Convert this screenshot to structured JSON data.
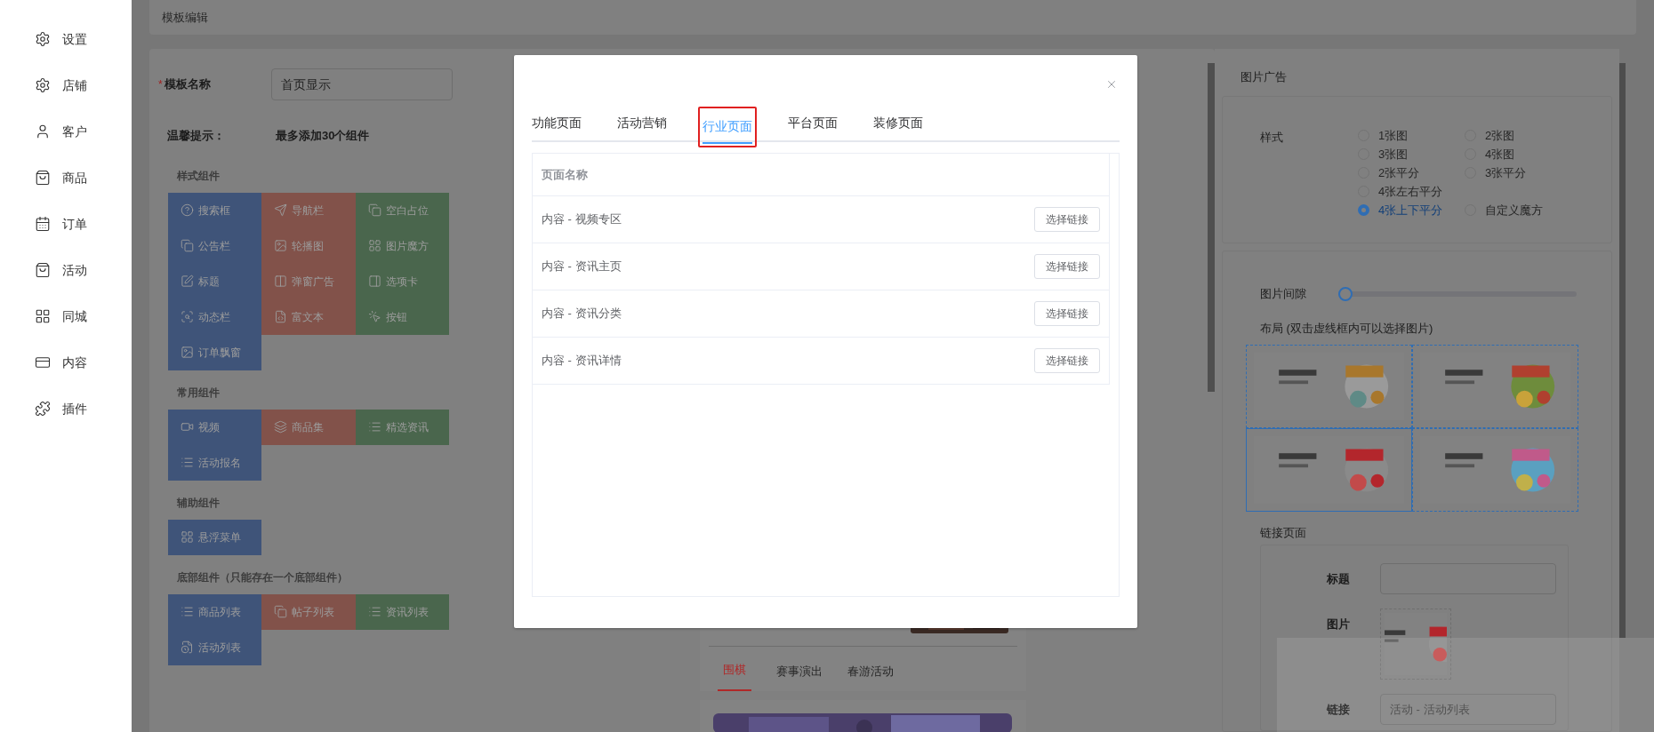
{
  "sidebar": {
    "items": [
      {
        "label": "设置"
      },
      {
        "label": "店铺"
      },
      {
        "label": "客户"
      },
      {
        "label": "商品"
      },
      {
        "label": "订单"
      },
      {
        "label": "活动"
      },
      {
        "label": "同城"
      },
      {
        "label": "内容"
      },
      {
        "label": "插件"
      }
    ]
  },
  "header": {
    "title": "模板编辑"
  },
  "editor": {
    "required_mark": "*",
    "name_label": "模板名称",
    "name_value": "首页显示",
    "tip_label": "温馨提示：",
    "tip_text": "最多添加30个组件",
    "groups": [
      {
        "title": "样式组件",
        "items": [
          {
            "label": "搜索框",
            "color": "#3f5479"
          },
          {
            "label": "导航栏",
            "color": "#82524a"
          },
          {
            "label": "空白占位",
            "color": "#4a664d"
          },
          {
            "label": "公告栏",
            "color": "#3f5479"
          },
          {
            "label": "轮播图",
            "color": "#82524a"
          },
          {
            "label": "图片魔方",
            "color": "#4a664d"
          },
          {
            "label": "标题",
            "color": "#3f5479"
          },
          {
            "label": "弹窗广告",
            "color": "#82524a"
          },
          {
            "label": "选项卡",
            "color": "#4a664d"
          },
          {
            "label": "动态栏",
            "color": "#3f5479"
          },
          {
            "label": "富文本",
            "color": "#82524a"
          },
          {
            "label": "按钮",
            "color": "#4a664d"
          },
          {
            "label": "订单飘窗",
            "color": "#3f5479"
          }
        ]
      },
      {
        "title": "常用组件",
        "items": [
          {
            "label": "视频",
            "color": "#3f5479"
          },
          {
            "label": "商品集",
            "color": "#82524a"
          },
          {
            "label": "精选资讯",
            "color": "#4a664d"
          },
          {
            "label": "活动报名",
            "color": "#3f5479"
          }
        ]
      },
      {
        "title": "辅助组件",
        "items": [
          {
            "label": "悬浮菜单",
            "color": "#3f5479"
          }
        ]
      },
      {
        "title": "底部组件（只能存在一个底部组件）",
        "items": [
          {
            "label": "商品列表",
            "color": "#3f5479"
          },
          {
            "label": "帖子列表",
            "color": "#82524a"
          },
          {
            "label": "资讯列表",
            "color": "#4a664d"
          },
          {
            "label": "活动列表",
            "color": "#3f5479"
          }
        ]
      }
    ]
  },
  "preview": {
    "tabs": [
      {
        "label": "围棋",
        "selected": true
      },
      {
        "label": "赛事演出",
        "selected": false
      },
      {
        "label": "春游活动",
        "selected": false
      }
    ]
  },
  "right_panel": {
    "title": "图片广告",
    "style_label": "样式",
    "option_rows": [
      [
        {
          "label": "1张图",
          "selected": false
        },
        {
          "label": "2张图",
          "selected": false
        }
      ],
      [
        {
          "label": "3张图",
          "selected": false
        },
        {
          "label": "4张图",
          "selected": false
        }
      ],
      [
        {
          "label": "2张平分",
          "selected": false
        },
        {
          "label": "3张平分",
          "selected": false
        }
      ],
      [
        {
          "label": "4张左右平分",
          "selected": false
        }
      ],
      [
        {
          "label": "4张上下平分",
          "selected": true
        },
        {
          "label": "自定义魔方",
          "selected": false
        }
      ]
    ],
    "gap_label": "图片间隙",
    "gap": {
      "level": 0
    },
    "layout_label": "布局 (双击虚线框内可以选择图片)",
    "cells": [
      {
        "selected": false
      },
      {
        "selected": false
      },
      {
        "selected": true
      },
      {
        "selected": false
      }
    ],
    "link_section": {
      "title": "链接页面",
      "title_label": "标题",
      "image_label": "图片",
      "link_label": "链接",
      "link_placeholder": "活动 - 活动列表"
    }
  },
  "modal": {
    "tabs": [
      {
        "label": "功能页面",
        "selected": false
      },
      {
        "label": "活动营销",
        "selected": false
      },
      {
        "label": "行业页面",
        "selected": true
      },
      {
        "label": "平台页面",
        "selected": false
      },
      {
        "label": "装修页面",
        "selected": false
      }
    ],
    "table": {
      "columns": [
        "页面名称"
      ],
      "rows": [
        {
          "name": "内容 - 视频专区",
          "action": "选择链接"
        },
        {
          "name": "内容 - 资讯主页",
          "action": "选择链接"
        },
        {
          "name": "内容 - 资讯分类",
          "action": "选择链接"
        },
        {
          "name": "内容 - 资讯详情",
          "action": "选择链接"
        }
      ]
    }
  }
}
